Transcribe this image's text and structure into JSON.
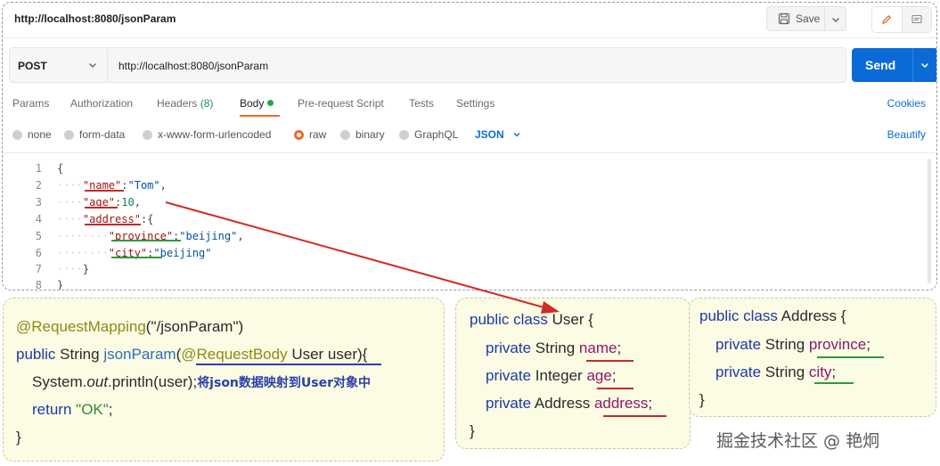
{
  "tab_title": "http://localhost:8080/jsonParam",
  "toolbar": {
    "save_label": "Save"
  },
  "request": {
    "method": "POST",
    "url": "http://localhost:8080/jsonParam",
    "send_label": "Send"
  },
  "request_tabs": {
    "params": "Params",
    "authorization": "Authorization",
    "headers": "Headers",
    "headers_count": "(8)",
    "body": "Body",
    "prerequest": "Pre-request Script",
    "tests": "Tests",
    "settings": "Settings",
    "cookies": "Cookies"
  },
  "body_types": {
    "none": "none",
    "form_data": "form-data",
    "urlencoded": "x-www-form-urlencoded",
    "raw": "raw",
    "binary": "binary",
    "graphql": "GraphQL",
    "format": "JSON",
    "beautify": "Beautify",
    "selected": "raw"
  },
  "editor": {
    "line_numbers": [
      "1",
      "2",
      "3",
      "4",
      "5",
      "6",
      "7",
      "8"
    ],
    "open_brace": "{",
    "close_brace": "}",
    "name_key": "\"name\"",
    "name_val": "\"Tom\"",
    "age_key": "\"age\"",
    "age_val": "10",
    "address_key": "\"address\"",
    "province_key": "\"province\"",
    "province_val": "\"beijing\"",
    "city_key": "\"city\"",
    "city_val": "\"beijing\""
  },
  "controller": {
    "annotation": "@RequestMapping",
    "mapping_path": "(\"/jsonParam\")",
    "public": "public",
    "return_type": "String",
    "method_name": "jsonParam",
    "param_annotation": "@RequestBody",
    "param": "User user",
    "print_prefix": "System.",
    "print_out": "out",
    "print_suffix": ".println(user);",
    "note": "将json数据映射到User对象中",
    "return_kw": "return",
    "return_val": "\"OK\"",
    "close": "}"
  },
  "user_class": {
    "decl_kw": "public class",
    "decl_name": "User {",
    "private": "private",
    "type_string": "String",
    "type_integer": "Integer",
    "type_address": "Address",
    "f_name": "name",
    "f_age": "age",
    "f_address": "address",
    "close": "}"
  },
  "address_class": {
    "decl_kw": "public class",
    "decl_name": "Address {",
    "private": "private",
    "type_string": "String",
    "f_province": "province",
    "f_city": "city",
    "close": "}"
  },
  "watermark": "掘金技术社区 @ 艳炯",
  "colors": {
    "send": "#0b6bd6",
    "active_tab": "#f06a2c",
    "body_dot": "#26a641",
    "arrow": "#d42a2a"
  }
}
